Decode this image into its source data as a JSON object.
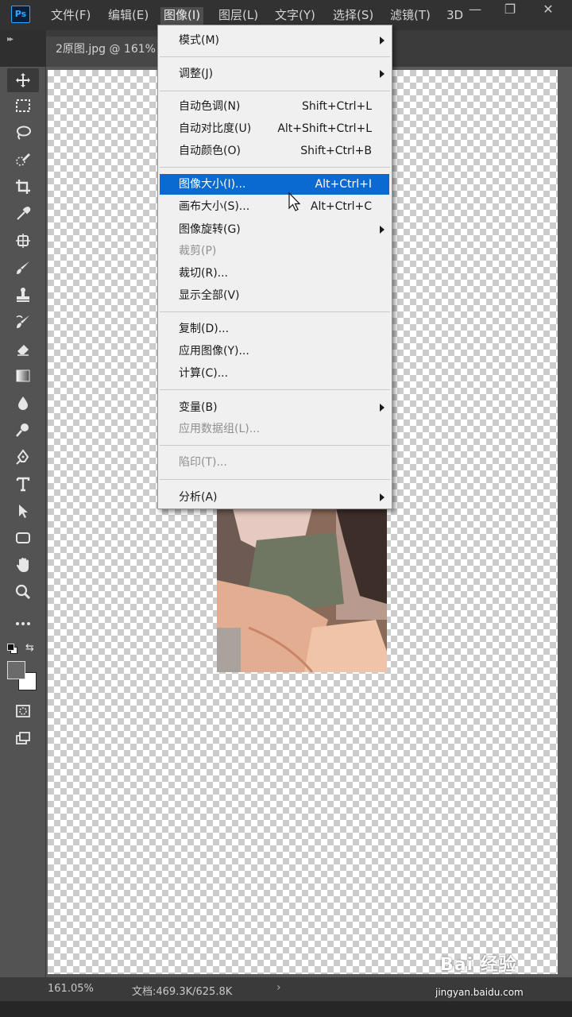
{
  "app": {
    "logo_text": "Ps"
  },
  "menubar": {
    "items": [
      {
        "label": "文件(F)"
      },
      {
        "label": "编辑(E)"
      },
      {
        "label": "图像(I)"
      },
      {
        "label": "图层(L)"
      },
      {
        "label": "文字(Y)"
      },
      {
        "label": "选择(S)"
      },
      {
        "label": "滤镜(T)"
      },
      {
        "label": "3D"
      }
    ],
    "active_index": 2,
    "window_controls": {
      "minimize": "—",
      "restore": "❐",
      "close": "✕"
    }
  },
  "document_tab": {
    "label": "2原图.jpg @ 161%"
  },
  "toolbar": {
    "tools": [
      "move-icon",
      "marquee-icon",
      "lasso-icon",
      "quick-select-icon",
      "crop-icon",
      "eyedropper-icon",
      "patch-icon",
      "brush-icon",
      "stamp-icon",
      "history-brush-icon",
      "eraser-icon",
      "gradient-icon",
      "blur-icon",
      "dodge-icon",
      "pen-icon",
      "type-icon",
      "path-select-icon",
      "rectangle-icon",
      "hand-icon",
      "zoom-icon",
      "more-icon"
    ],
    "foreground_color": "#6b6b6b",
    "background_color": "#ffffff"
  },
  "image_menu": {
    "items": [
      {
        "label": "模式(M)",
        "shortcut": "",
        "submenu": true,
        "disabled": false
      },
      {
        "label": "调整(J)",
        "shortcut": "",
        "submenu": true,
        "disabled": false
      },
      {
        "label": "自动色调(N)",
        "shortcut": "Shift+Ctrl+L",
        "submenu": false,
        "disabled": false
      },
      {
        "label": "自动对比度(U)",
        "shortcut": "Alt+Shift+Ctrl+L",
        "submenu": false,
        "disabled": false
      },
      {
        "label": "自动颜色(O)",
        "shortcut": "Shift+Ctrl+B",
        "submenu": false,
        "disabled": false
      },
      {
        "label": "图像大小(I)...",
        "shortcut": "Alt+Ctrl+I",
        "submenu": false,
        "disabled": false,
        "highlighted": true
      },
      {
        "label": "画布大小(S)...",
        "shortcut": "Alt+Ctrl+C",
        "submenu": false,
        "disabled": false
      },
      {
        "label": "图像旋转(G)",
        "shortcut": "",
        "submenu": true,
        "disabled": false
      },
      {
        "label": "裁剪(P)",
        "shortcut": "",
        "submenu": false,
        "disabled": true
      },
      {
        "label": "裁切(R)...",
        "shortcut": "",
        "submenu": false,
        "disabled": false
      },
      {
        "label": "显示全部(V)",
        "shortcut": "",
        "submenu": false,
        "disabled": false
      },
      {
        "label": "复制(D)...",
        "shortcut": "",
        "submenu": false,
        "disabled": false
      },
      {
        "label": "应用图像(Y)...",
        "shortcut": "",
        "submenu": false,
        "disabled": false
      },
      {
        "label": "计算(C)...",
        "shortcut": "",
        "submenu": false,
        "disabled": false
      },
      {
        "label": "变量(B)",
        "shortcut": "",
        "submenu": true,
        "disabled": false
      },
      {
        "label": "应用数据组(L)...",
        "shortcut": "",
        "submenu": false,
        "disabled": true
      },
      {
        "label": "陷印(T)...",
        "shortcut": "",
        "submenu": false,
        "disabled": true
      },
      {
        "label": "分析(A)",
        "shortcut": "",
        "submenu": true,
        "disabled": false
      }
    ]
  },
  "statusbar": {
    "zoom": "161.05%",
    "doc_info": "文档:469.3K/625.8K",
    "arrow": "›"
  },
  "watermark": {
    "brand": "Bai 经验",
    "url": "jingyan.baidu.com"
  }
}
